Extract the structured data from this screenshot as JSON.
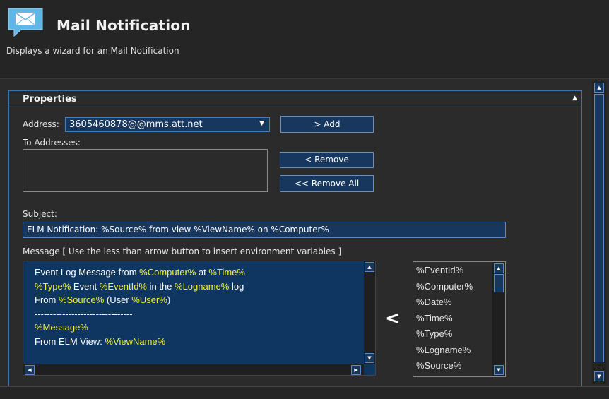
{
  "header": {
    "title": "Mail Notification",
    "subtitle": "Displays a wizard for an Mail Notification",
    "icon": "mail-envelope-icon"
  },
  "panel": {
    "title": "Properties",
    "address_label": "Address:",
    "address_value": "3605460878@@mms.att.net",
    "add_button": "> Add",
    "to_addresses_label": "To Addresses:",
    "to_addresses": [],
    "remove_button": "< Remove",
    "remove_all_button": "<< Remove All",
    "subject_label": "Subject:",
    "subject_value": "ELM Notification: %Source% from view %ViewName% on %Computer%",
    "message_label": "Message [ Use the less than arrow button to insert environment variables ]",
    "message_lines": [
      [
        {
          "t": "Event Log Message from ",
          "v": false
        },
        {
          "t": "%Computer%",
          "v": true
        },
        {
          "t": " at ",
          "v": false
        },
        {
          "t": "%Time%",
          "v": true
        }
      ],
      [
        {
          "t": "%Type%",
          "v": true
        },
        {
          "t": " Event ",
          "v": false
        },
        {
          "t": "%EventId%",
          "v": true
        },
        {
          "t": " in the ",
          "v": false
        },
        {
          "t": "%Logname%",
          "v": true
        },
        {
          "t": " log",
          "v": false
        }
      ],
      [
        {
          "t": "From ",
          "v": false
        },
        {
          "t": "%Source%",
          "v": true
        },
        {
          "t": " (User ",
          "v": false
        },
        {
          "t": "%User%",
          "v": true
        },
        {
          "t": ")",
          "v": false
        }
      ],
      [
        {
          "t": "--------------------------------",
          "v": false
        }
      ],
      [
        {
          "t": "%Message%",
          "v": true
        }
      ],
      [
        {
          "t": "From ELM View: ",
          "v": false
        },
        {
          "t": "%ViewName%",
          "v": true
        }
      ]
    ],
    "insert_button": "<",
    "variables": [
      "%EventId%",
      "%Computer%",
      "%Date%",
      "%Time%",
      "%Type%",
      "%Logname%",
      "%Source%"
    ]
  },
  "colors": {
    "background": "#2b2b2b",
    "accent": "#17375e",
    "border_accent": "#3d73a8",
    "variable_highlight": "#f2f23c"
  }
}
